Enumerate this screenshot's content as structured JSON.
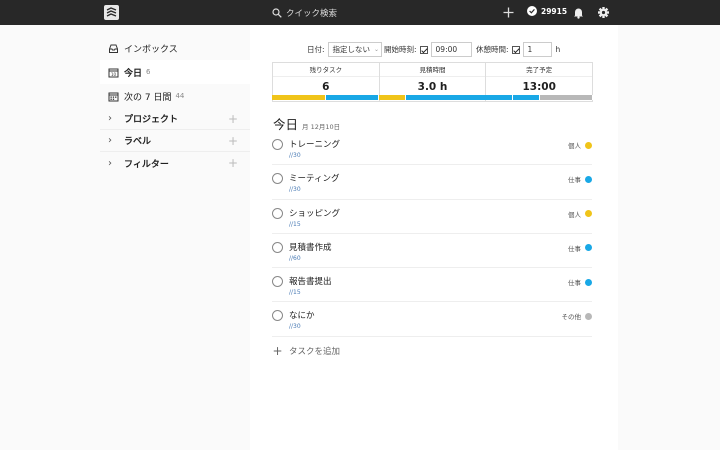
{
  "topbar": {
    "search_placeholder": "クイック検索",
    "karma": "29915"
  },
  "sidebar": {
    "items": [
      {
        "label": "インボックス",
        "count": "",
        "icon": "inbox-icon"
      },
      {
        "label": "今日",
        "count": "6",
        "icon": "calendar-today-icon"
      },
      {
        "label": "次の 7 日間",
        "count": "44",
        "icon": "calendar-week-icon"
      }
    ],
    "groups": [
      {
        "label": "プロジェクト"
      },
      {
        "label": "ラベル"
      },
      {
        "label": "フィルター"
      }
    ]
  },
  "controls": {
    "date_label": "日付:",
    "date_value": "指定しない",
    "start_label": "開始時刻:",
    "start_value": "09:00",
    "break_label": "休憩時間:",
    "break_value": "1",
    "break_unit": "h"
  },
  "stats": {
    "remaining_label": "残りタスク",
    "remaining_value": "6",
    "estimate_label": "見積時間",
    "estimate_value": "3.0 h",
    "finish_label": "完了予定",
    "finish_value": "13:00"
  },
  "progress_segments": [
    {
      "minutes": 30,
      "color": "#f0c419"
    },
    {
      "minutes": 30,
      "color": "#19a8e6"
    },
    {
      "minutes": 15,
      "color": "#f0c419"
    },
    {
      "minutes": 60,
      "color": "#19a8e6"
    },
    {
      "minutes": 15,
      "color": "#19a8e6"
    },
    {
      "minutes": 30,
      "color": "#b8b8b8"
    }
  ],
  "today": {
    "title": "今日",
    "date": "月 12月10日"
  },
  "tasks": [
    {
      "name": "トレーニング",
      "meta": "//30",
      "label": "個人",
      "color": "#f0c419"
    },
    {
      "name": "ミーティング",
      "meta": "//30",
      "label": "仕事",
      "color": "#19a8e6"
    },
    {
      "name": "ショッピング",
      "meta": "//15",
      "label": "個人",
      "color": "#f0c419"
    },
    {
      "name": "見積書作成",
      "meta": "//60",
      "label": "仕事",
      "color": "#19a8e6"
    },
    {
      "name": "報告書提出",
      "meta": "//15",
      "label": "仕事",
      "color": "#19a8e6"
    },
    {
      "name": "なにか",
      "meta": "//30",
      "label": "その他",
      "color": "#b8b8b8"
    }
  ],
  "add_task_label": "タスクを追加"
}
